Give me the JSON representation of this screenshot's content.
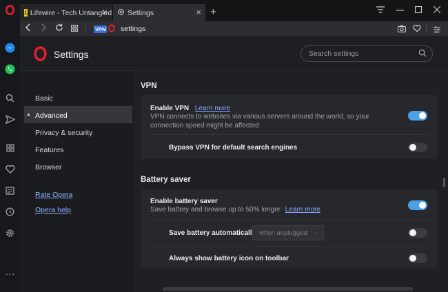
{
  "tabs": [
    {
      "label": "Lifewire - Tech Untangled",
      "icon": "lifewire-logo-icon",
      "close": "×"
    },
    {
      "label": "Settings",
      "icon": "gear-icon",
      "close": "×"
    }
  ],
  "tabbar": {
    "new_tab": "+"
  },
  "address_bar": {
    "vpn_badge": "VPN",
    "url": "settings"
  },
  "settings": {
    "title": "Settings",
    "search_placeholder": "Search settings",
    "nav": {
      "basic": "Basic",
      "advanced": "Advanced",
      "advanced_caret": "▲",
      "privacy": "Privacy & security",
      "features": "Features",
      "browser": "Browser",
      "rate": "Rate Opera",
      "help": "Opera help"
    },
    "vpn": {
      "section_title": "VPN",
      "enable_title": "Enable VPN",
      "enable_link": "Learn more",
      "enable_desc": "VPN connects to websites via various servers around the world, so your connection speed might be affected",
      "enable_on": true,
      "bypass_title": "Bypass VPN for default search engines",
      "bypass_on": false
    },
    "battery": {
      "section_title": "Battery saver",
      "enable_title": "Enable battery saver",
      "enable_desc": "Save battery and browse up to 50% longer",
      "enable_link": "Learn more",
      "enable_on": true,
      "auto_title": "Save battery automatically",
      "auto_dropdown": "when unplugged",
      "auto_on": false,
      "icon_title": "Always show battery icon on toolbar",
      "icon_on": false
    }
  },
  "colors": {
    "accent": "#4aa1e6",
    "opera_red": "#e0212c",
    "link": "#89a8ff"
  }
}
